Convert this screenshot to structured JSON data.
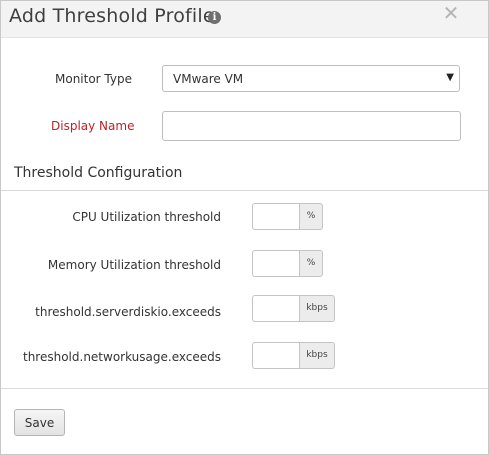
{
  "dialog": {
    "title": "Add Threshold Profile",
    "info_icon": "info-icon",
    "close_icon": "close-icon",
    "close_glyph": "✕"
  },
  "form": {
    "monitor_type_label": "Monitor Type",
    "monitor_type_value": "VMware VM",
    "display_name_label": "Display Name",
    "display_name_value": "",
    "display_name_color": "#b2262b"
  },
  "threshold_section": {
    "title": "Threshold Configuration",
    "rows": [
      {
        "label": "CPU Utilization threshold",
        "value": "",
        "unit": "%"
      },
      {
        "label": "Memory Utilization threshold",
        "value": "",
        "unit": "%"
      },
      {
        "label": "threshold.serverdiskio.exceeds",
        "value": "",
        "unit": "kbps"
      },
      {
        "label": "threshold.networkusage.exceeds",
        "value": "",
        "unit": "kbps"
      }
    ]
  },
  "actions": {
    "save_label": "Save"
  }
}
